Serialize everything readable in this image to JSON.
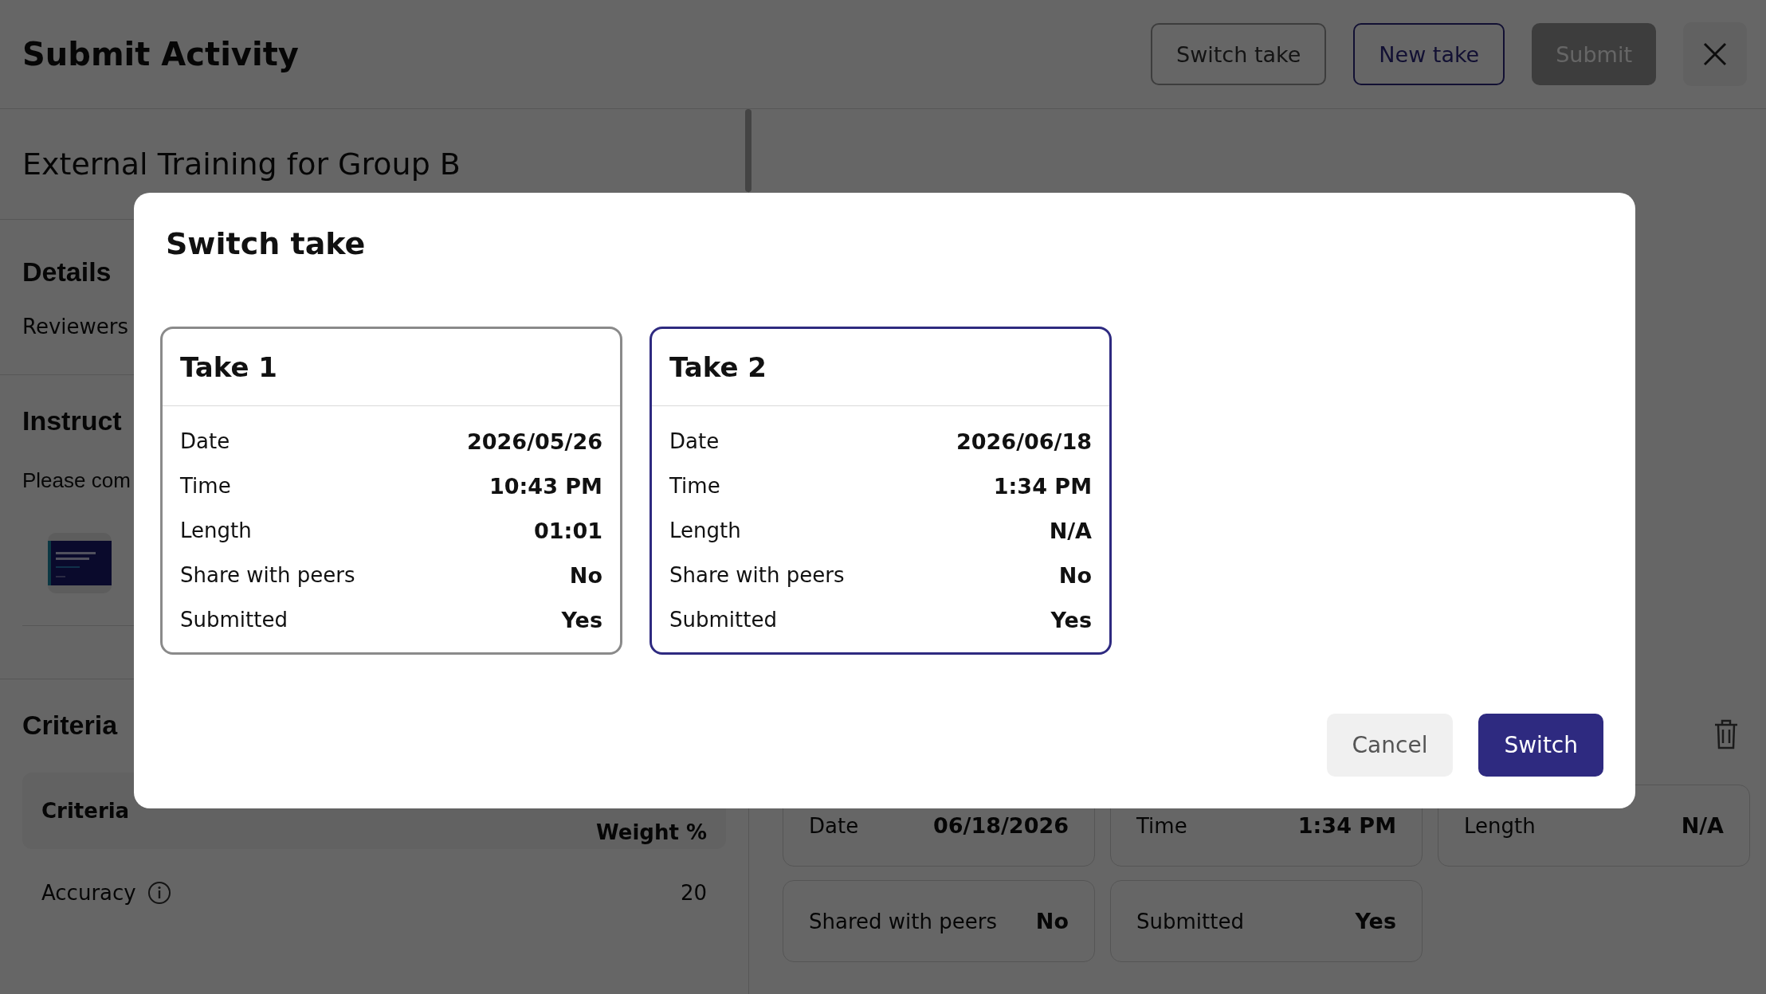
{
  "header": {
    "title": "Submit Activity",
    "buttons": [
      {
        "label": "Switch take",
        "kind": "secondary",
        "disabled": false
      },
      {
        "label": "New take",
        "kind": "outline",
        "disabled": false
      },
      {
        "label": "Submit",
        "kind": "primary",
        "disabled": true
      }
    ]
  },
  "activity": {
    "title": "External Training for Group B",
    "details": {
      "heading": "Details",
      "label": "Reviewers"
    },
    "instructions": {
      "heading": "Instruct",
      "text": "Please com"
    },
    "criteria": {
      "heading": "Criteria",
      "columns": [
        "Criteria",
        "Weight %"
      ],
      "rows": [
        {
          "name": "Accuracy",
          "weight": "20"
        }
      ]
    }
  },
  "take_details": [
    {
      "label": "Date",
      "value": "06/18/2026"
    },
    {
      "label": "Time",
      "value": "1:34 PM"
    },
    {
      "label": "Length",
      "value": "N/A"
    },
    {
      "label": "Shared with peers",
      "value": "No"
    },
    {
      "label": "Submitted",
      "value": "Yes"
    }
  ],
  "dialog": {
    "title": "Switch take",
    "takes": [
      {
        "title": "Take 1",
        "selected": false,
        "rows": [
          {
            "label": "Date",
            "value": "2026/05/26"
          },
          {
            "label": "Time",
            "value": "10:43 PM"
          },
          {
            "label": "Length",
            "value": "01:01"
          },
          {
            "label": "Share with peers",
            "value": "No"
          },
          {
            "label": "Submitted",
            "value": "Yes"
          }
        ]
      },
      {
        "title": "Take 2",
        "selected": true,
        "rows": [
          {
            "label": "Date",
            "value": "2026/06/18"
          },
          {
            "label": "Time",
            "value": "1:34 PM"
          },
          {
            "label": "Length",
            "value": "N/A"
          },
          {
            "label": "Share with peers",
            "value": "No"
          },
          {
            "label": "Submitted",
            "value": "Yes"
          }
        ]
      }
    ],
    "buttons": [
      {
        "label": "Cancel",
        "kind": "secondary"
      },
      {
        "label": "Switch",
        "kind": "primary"
      }
    ]
  }
}
